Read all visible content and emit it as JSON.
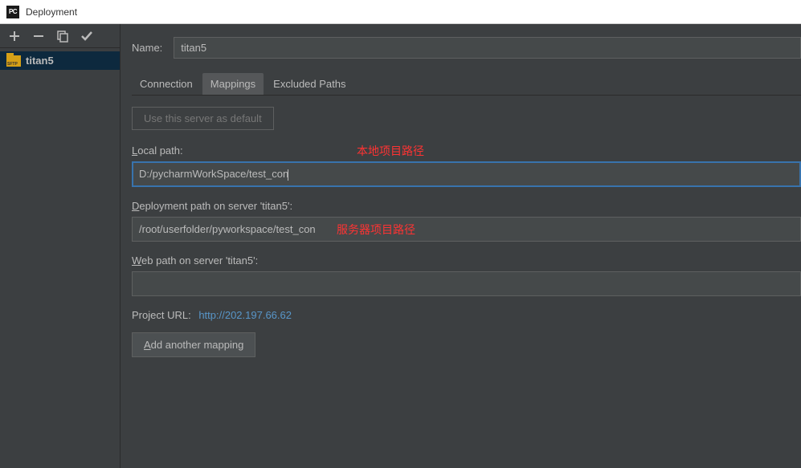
{
  "window": {
    "title": "Deployment",
    "icon_label": "PC"
  },
  "sidebar": {
    "items": [
      {
        "label": "titan5",
        "type": "sftp",
        "selected": true
      }
    ]
  },
  "form": {
    "name_label": "Name:",
    "name_value": "titan5",
    "tabs": [
      "Connection",
      "Mappings",
      "Excluded Paths"
    ],
    "active_tab": 1,
    "default_btn": "Use this server as default",
    "local_path_label": "Local path:",
    "local_path_value": "D:/pycharmWorkSpace/test_con",
    "deploy_path_label": "Deployment path on server 'titan5':",
    "deploy_path_value": "/root/userfolder/pyworkspace/test_con",
    "web_path_label": "Web path on server 'titan5':",
    "web_path_value": "",
    "project_url_label": "Project URL:",
    "project_url_value": "http://202.197.66.62",
    "add_mapping_btn": "Add another mapping"
  },
  "annotations": {
    "local": "本地项目路径",
    "deploy": "服务器项目路径"
  }
}
